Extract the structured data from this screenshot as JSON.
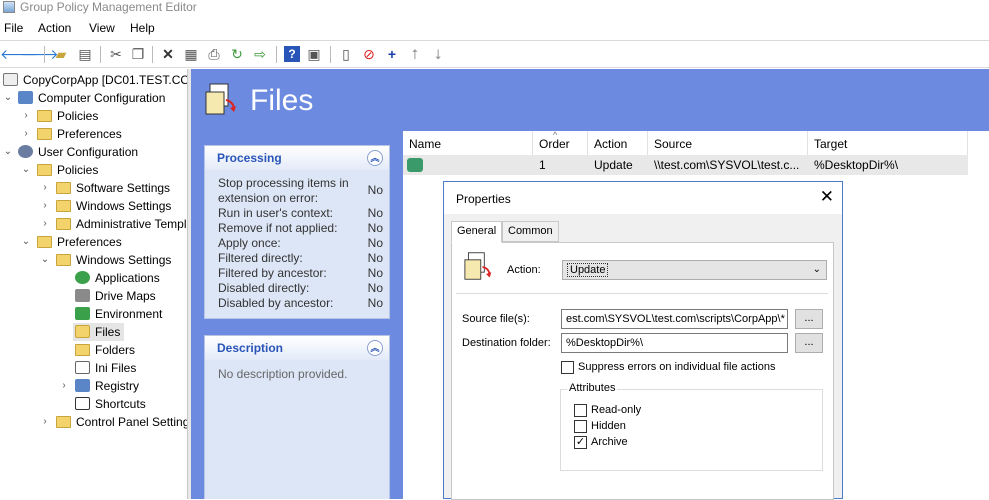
{
  "window": {
    "title": "Group Policy Management Editor"
  },
  "menu": [
    "File",
    "Action",
    "View",
    "Help"
  ],
  "toolbar_icons": [
    "back-icon",
    "forward-icon",
    "up-folder-icon",
    "show-hide-tree-icon",
    "cut-icon",
    "copy-icon",
    "delete-icon",
    "properties-icon",
    "print-icon",
    "refresh-icon",
    "export-icon",
    "help-icon",
    "show-hide-action-pane-icon",
    "new-item-icon",
    "stop-icon",
    "add-icon",
    "move-up-icon",
    "move-down-icon"
  ],
  "tree": {
    "root": "CopyCorpApp [DC01.TEST.COM",
    "items": [
      "Computer Configuration",
      "Policies",
      "Preferences",
      "User Configuration",
      "Policies",
      "Software Settings",
      "Windows Settings",
      "Administrative Templ",
      "Preferences",
      "Windows Settings",
      "Applications",
      "Drive Maps",
      "Environment",
      "Files",
      "Folders",
      "Ini Files",
      "Registry",
      "Shortcuts",
      "Control Panel Setting"
    ]
  },
  "main": {
    "title": "Files",
    "processing": {
      "header": "Processing",
      "rows": [
        {
          "label": "Stop processing items in extension on error:",
          "value": "No"
        },
        {
          "label": "Run in user's context:",
          "value": "No"
        },
        {
          "label": "Remove if not applied:",
          "value": "No"
        },
        {
          "label": "Apply once:",
          "value": "No"
        },
        {
          "label": "Filtered directly:",
          "value": "No"
        },
        {
          "label": "Filtered by ancestor:",
          "value": "No"
        },
        {
          "label": "Disabled directly:",
          "value": "No"
        },
        {
          "label": "Disabled by ancestor:",
          "value": "No"
        }
      ]
    },
    "description": {
      "header": "Description",
      "text": "No description provided."
    }
  },
  "list": {
    "columns": [
      "Name",
      "Order",
      "Action",
      "Source",
      "Target"
    ],
    "rows": [
      {
        "name": "",
        "order": "1",
        "action": "Update",
        "source": "\\\\test.com\\SYSVOL\\test.c...",
        "target": "%DesktopDir%\\"
      }
    ]
  },
  "dialog": {
    "title": "Properties",
    "tabs": [
      "General",
      "Common"
    ],
    "action_label": "Action:",
    "action_value": "Update",
    "source_label": "Source file(s):",
    "source_value": "est.com\\SYSVOL\\test.com\\scripts\\CorpApp\\*",
    "dest_label": "Destination folder:",
    "dest_value": "%DesktopDir%\\",
    "browse_label": "...",
    "suppress_label": "Suppress errors on individual file actions",
    "attributes_label": "Attributes",
    "attributes": [
      {
        "label": "Read-only",
        "checked": false
      },
      {
        "label": "Hidden",
        "checked": false
      },
      {
        "label": "Archive",
        "checked": true
      }
    ]
  }
}
